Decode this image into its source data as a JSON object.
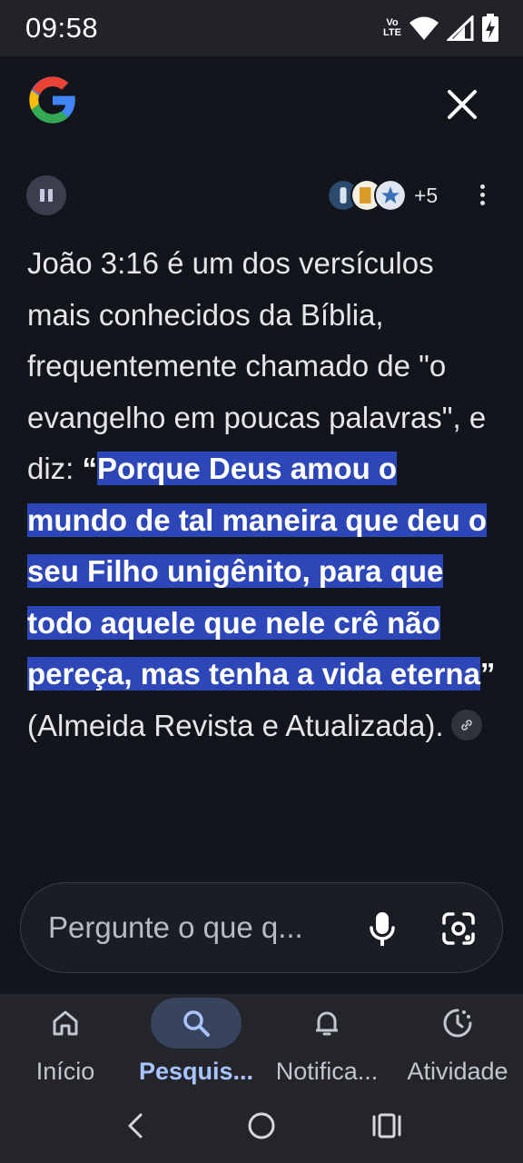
{
  "status_bar": {
    "time": "09:58",
    "volte_top": "Vo",
    "volte_bottom": "LTE",
    "icons": [
      "volte-lte-icon",
      "wifi-icon",
      "signal-icon",
      "battery-charging-icon"
    ]
  },
  "header": {
    "logo": "google-g-logo",
    "close_icon": "close-icon"
  },
  "toolbar": {
    "pause_icon": "pause-icon",
    "source_icons": [
      "source-favicon-1",
      "source-favicon-2",
      "source-favicon-3"
    ],
    "source_count": "+5",
    "more_icon": "more-vert-icon"
  },
  "answer": {
    "intro": "João 3:16 é um dos versículos mais conhecidos da Bíblia, frequentemente chamado de \"o evangelho em poucas palavras\", e diz: ",
    "open_quote": "“",
    "highlight": "Porque Deus amou o mundo de tal maneira que deu o seu Filho unigênito, para que todo aquele que nele crê não pereça, mas tenha a vida eterna",
    "close_quote": "”",
    "outro": " (Almeida Revista e Atualizada).",
    "link_icon": "link-icon"
  },
  "ask_bar": {
    "placeholder": "Pergunte o que q...",
    "mic_icon": "mic-icon",
    "lens_icon": "google-lens-icon"
  },
  "bottom_nav": {
    "items": [
      {
        "label": "Início",
        "icon": "home-icon",
        "active": false
      },
      {
        "label": "Pesquis...",
        "icon": "search-icon",
        "active": true
      },
      {
        "label": "Notifica...",
        "icon": "bell-icon",
        "active": false
      },
      {
        "label": "Atividade",
        "icon": "activity-icon",
        "active": false
      }
    ]
  },
  "system_nav": {
    "icons": [
      "back-icon",
      "home-circle-icon",
      "recents-icon"
    ]
  },
  "colors": {
    "background": "#13151c",
    "highlight": "#2d47b8",
    "active_nav_text": "#a9c3ff",
    "active_nav_pill": "#38445e"
  }
}
